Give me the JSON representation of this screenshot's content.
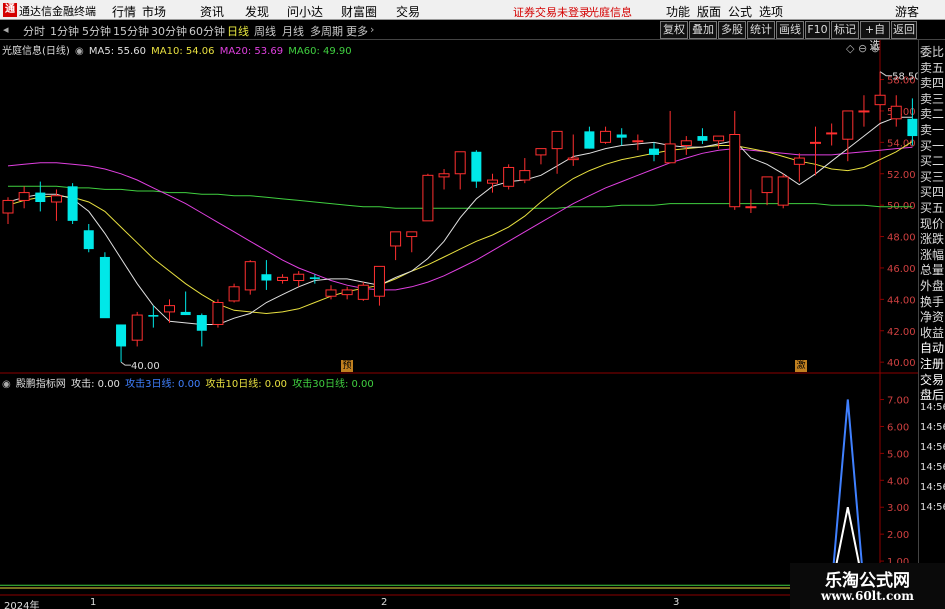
{
  "app": {
    "logo": "通",
    "title": "通达信金融终端"
  },
  "menu": [
    "行情",
    "市场",
    "资讯",
    "发现",
    "问小达",
    "财富圈",
    "交易"
  ],
  "notice": {
    "login": "证券交易未登录",
    "stock": "光庭信息"
  },
  "menu_right": [
    "功能",
    "版面",
    "公式",
    "选项"
  ],
  "guest": "游客",
  "periods": [
    "分时",
    "1分钟",
    "5分钟",
    "15分钟",
    "30分钟",
    "60分钟",
    "日线",
    "周线",
    "月线",
    "多周期",
    "更多"
  ],
  "selected_period": "日线",
  "toolbar_right": [
    "复权",
    "叠加",
    "多股",
    "统计",
    "画线",
    "F10",
    "标记",
    "+自选",
    "返回"
  ],
  "main_legend": {
    "name": "光庭信息(日线)",
    "ma": [
      {
        "label": "MA5: 55.60",
        "color": "#e0e0e0"
      },
      {
        "label": "MA10: 54.06",
        "color": "#e8e040"
      },
      {
        "label": "MA20: 53.69",
        "color": "#e040e0"
      },
      {
        "label": "MA60: 49.90",
        "color": "#40d040"
      }
    ]
  },
  "sub_legend": {
    "name": "殿鹏指标网",
    "items": [
      {
        "label": "攻击: 0.00",
        "color": "#e0e0e0"
      },
      {
        "label": "攻击3日线: 0.00",
        "color": "#4080ff"
      },
      {
        "label": "攻击10日线: 0.00",
        "color": "#e8e040"
      },
      {
        "label": "攻击30日线: 0.00",
        "color": "#40d040"
      }
    ]
  },
  "side_items": [
    "委比",
    "卖五",
    "卖四",
    "卖三",
    "卖二",
    "卖一",
    "买一",
    "买二",
    "买三",
    "买四",
    "买五",
    "现价",
    "涨跌",
    "涨幅",
    "总量",
    "外盘",
    "换手",
    "净资",
    "收益",
    "自动",
    "注册",
    "交易",
    "盘后",
    "14:56",
    "14:56",
    "14:56",
    "14:56",
    "14:56",
    "14:56"
  ],
  "date_axis": {
    "year": "2024年",
    "marks": [
      "1",
      "2",
      "3"
    ]
  },
  "markers": {
    "pre_left": "预",
    "pre_right": "激"
  },
  "watermark": {
    "line1": "乐淘公式网",
    "line2": "www.60lt.com"
  },
  "chart_data": [
    {
      "type": "candlestick",
      "ylim": [
        39.5,
        59.5
      ],
      "yticks": [
        "58.00",
        "56.00",
        "54.00",
        "52.00",
        "50.00",
        "48.00",
        "46.00",
        "44.00",
        "42.00",
        "40.00"
      ],
      "high_label": "58.50",
      "low_label": "40.00",
      "candles": [
        [
          49.5,
          50.5,
          48.8,
          50.3
        ],
        [
          50.3,
          51.2,
          49.8,
          50.8
        ],
        [
          50.8,
          51.5,
          49.6,
          50.2
        ],
        [
          50.2,
          51.0,
          49.0,
          50.6
        ],
        [
          51.2,
          51.4,
          48.8,
          49.0
        ],
        [
          48.4,
          48.8,
          47.0,
          47.2
        ],
        [
          46.7,
          47.0,
          43.0,
          42.8
        ],
        [
          42.4,
          42.4,
          40.0,
          41.0
        ],
        [
          41.4,
          43.2,
          41.0,
          43.0
        ],
        [
          43.0,
          43.6,
          42.2,
          42.9
        ],
        [
          43.2,
          44.0,
          42.5,
          43.6
        ],
        [
          43.2,
          44.5,
          43.0,
          43.0
        ],
        [
          43.0,
          43.1,
          41.0,
          42.0
        ],
        [
          42.4,
          44.0,
          42.2,
          43.8
        ],
        [
          43.9,
          45.0,
          43.8,
          44.8
        ],
        [
          44.6,
          46.5,
          44.3,
          46.4
        ],
        [
          45.6,
          46.5,
          44.6,
          45.2
        ],
        [
          45.2,
          45.6,
          45.0,
          45.4
        ],
        [
          45.2,
          45.8,
          44.8,
          45.6
        ],
        [
          45.4,
          45.6,
          45.0,
          45.3
        ],
        [
          44.2,
          44.9,
          44.0,
          44.6
        ],
        [
          44.3,
          44.8,
          44.0,
          44.6
        ],
        [
          44.0,
          45.1,
          43.9,
          44.9
        ],
        [
          44.2,
          45.8,
          43.6,
          46.1
        ],
        [
          47.4,
          48.0,
          46.5,
          48.3
        ],
        [
          48.0,
          48.3,
          47.0,
          48.3
        ],
        [
          49.0,
          52.0,
          49.0,
          51.9
        ],
        [
          51.8,
          52.3,
          51.0,
          52.0
        ],
        [
          52.0,
          53.0,
          51.0,
          53.4
        ],
        [
          53.4,
          53.5,
          51.1,
          51.5
        ],
        [
          51.4,
          52.0,
          50.8,
          51.6
        ],
        [
          51.2,
          52.6,
          51.0,
          52.4
        ],
        [
          51.6,
          53.0,
          51.4,
          52.2
        ],
        [
          53.2,
          53.5,
          52.6,
          53.6
        ],
        [
          53.6,
          54.4,
          52.0,
          54.7
        ],
        [
          52.9,
          54.5,
          52.5,
          53.0
        ],
        [
          54.7,
          55.0,
          53.6,
          53.6
        ],
        [
          54.0,
          55.0,
          53.9,
          54.7
        ],
        [
          54.5,
          54.9,
          53.8,
          54.3
        ],
        [
          54.1,
          54.5,
          53.5,
          54.1
        ],
        [
          53.6,
          54.0,
          52.8,
          53.2
        ],
        [
          52.7,
          56.0,
          52.7,
          53.9
        ],
        [
          53.8,
          54.4,
          53.2,
          54.1
        ],
        [
          54.4,
          54.9,
          53.9,
          54.1
        ],
        [
          54.1,
          54.3,
          53.6,
          54.4
        ],
        [
          49.9,
          56.0,
          49.7,
          54.5
        ],
        [
          49.9,
          51.0,
          49.5,
          49.9
        ],
        [
          50.8,
          51.8,
          50.0,
          51.8
        ],
        [
          50.0,
          52.0,
          49.8,
          51.8
        ],
        [
          52.6,
          53.3,
          51.5,
          53.0
        ],
        [
          54.0,
          55.0,
          51.9,
          54.0
        ],
        [
          54.6,
          55.2,
          53.8,
          54.6
        ],
        [
          54.2,
          55.9,
          52.8,
          56.0
        ],
        [
          56.0,
          57.0,
          55.0,
          56.0
        ],
        [
          56.4,
          58.5,
          55.4,
          57.0
        ],
        [
          55.5,
          57.0,
          55.0,
          56.3
        ],
        [
          55.5,
          56.8,
          53.8,
          54.4
        ]
      ],
      "ma5": [
        50.2,
        50.5,
        50.7,
        50.7,
        50.4,
        49.6,
        48.2,
        46.6,
        45.0,
        43.6,
        42.6,
        42.5,
        42.4,
        42.4,
        42.8,
        43.1,
        43.8,
        44.3,
        44.8,
        45.2,
        45.3,
        45.3,
        45.1,
        44.9,
        45.4,
        45.8,
        46.6,
        47.7,
        49.2,
        50.4,
        51.2,
        51.5,
        51.6,
        51.9,
        52.5,
        53.1,
        53.3,
        53.6,
        53.8,
        53.9,
        54.0,
        53.8,
        53.7,
        53.7,
        53.9,
        54.1,
        53.0,
        52.6,
        52.0,
        51.3,
        52.0,
        52.8,
        53.6,
        54.4,
        55.2,
        55.6,
        55.6
      ],
      "ma10": [
        50.0,
        50.3,
        50.5,
        50.6,
        50.5,
        50.2,
        49.6,
        48.6,
        47.6,
        46.6,
        45.8,
        45.0,
        44.3,
        43.7,
        43.3,
        43.2,
        43.1,
        43.2,
        43.4,
        43.8,
        44.2,
        44.5,
        44.7,
        44.9,
        45.3,
        45.8,
        46.2,
        46.7,
        47.2,
        47.7,
        48.1,
        48.6,
        49.3,
        50.2,
        51.0,
        51.7,
        52.2,
        52.6,
        52.9,
        53.1,
        53.3,
        53.5,
        53.6,
        53.7,
        53.8,
        53.8,
        53.6,
        53.4,
        53.1,
        52.8,
        52.6,
        52.3,
        52.2,
        52.4,
        52.9,
        53.4,
        54.06
      ],
      "ma20": [
        52.5,
        52.6,
        52.7,
        52.7,
        52.6,
        52.5,
        52.3,
        52.0,
        51.6,
        51.1,
        50.6,
        50.1,
        49.5,
        48.9,
        48.3,
        47.7,
        47.1,
        46.5,
        46.0,
        45.6,
        45.2,
        44.9,
        44.7,
        44.6,
        44.6,
        44.8,
        45.1,
        45.5,
        46.0,
        46.5,
        47.1,
        47.7,
        48.3,
        48.9,
        49.5,
        50.1,
        50.6,
        51.1,
        51.5,
        51.9,
        52.3,
        52.7,
        53.0,
        53.3,
        53.5,
        53.6,
        53.5,
        53.4,
        53.3,
        53.2,
        53.2,
        53.2,
        53.3,
        53.4,
        53.5,
        53.6,
        53.69
      ],
      "ma60": [
        51.2,
        51.2,
        51.2,
        51.2,
        51.1,
        51.1,
        51.0,
        51.0,
        50.9,
        50.9,
        50.8,
        50.8,
        50.7,
        50.7,
        50.6,
        50.6,
        50.5,
        50.4,
        50.3,
        50.2,
        50.1,
        50.0,
        49.9,
        49.9,
        49.8,
        49.8,
        49.8,
        49.8,
        49.8,
        49.8,
        49.8,
        49.8,
        49.8,
        49.8,
        49.8,
        49.9,
        49.9,
        49.9,
        50.0,
        50.0,
        50.0,
        50.1,
        50.1,
        50.1,
        50.1,
        50.1,
        50.1,
        50.1,
        50.1,
        50.1,
        50.1,
        50.0,
        50.0,
        50.0,
        49.9,
        49.9,
        49.9
      ]
    },
    {
      "type": "line",
      "ylim": [
        0,
        7.8
      ],
      "yticks": [
        "7.00",
        "6.00",
        "5.00",
        "4.00",
        "3.00",
        "2.00",
        "1.00"
      ],
      "series": [
        {
          "name": "攻击3日线",
          "color": "#4080ff",
          "spike_index": 52,
          "values_at_spike": [
            0,
            7.0,
            0
          ]
        },
        {
          "name": "攻击",
          "color": "#ffffff",
          "spike_index": 52,
          "values_at_spike": [
            0,
            3.0,
            0
          ]
        },
        {
          "name": "攻击30日线",
          "color": "#40d040",
          "values": [
            0.1
          ]
        }
      ]
    }
  ]
}
